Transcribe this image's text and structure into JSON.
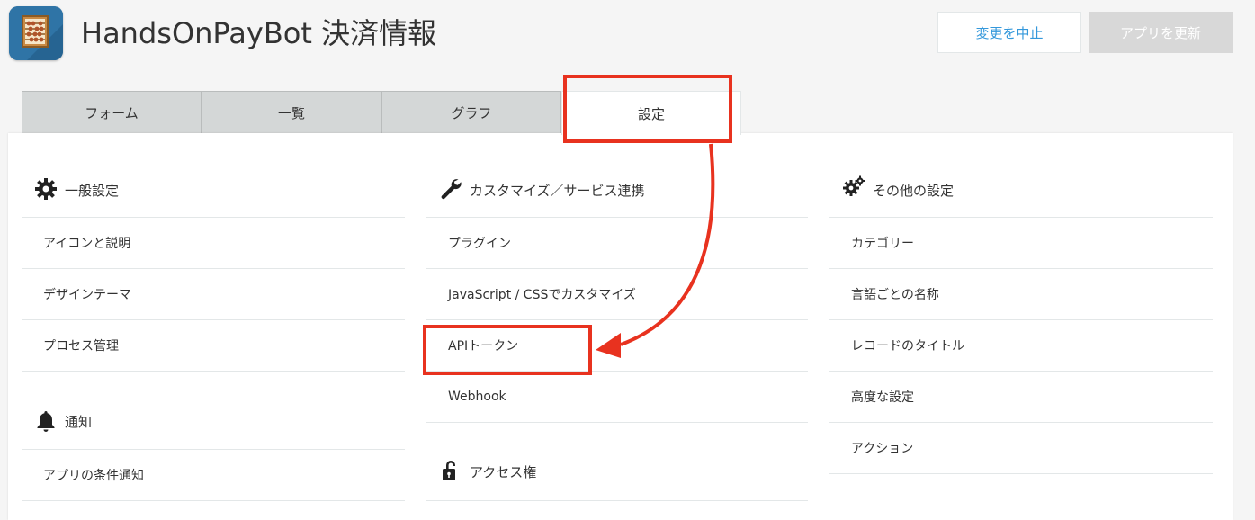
{
  "header": {
    "title": "HandsOnPayBot 決済情報",
    "cancel_label": "変更を中止",
    "update_label": "アプリを更新"
  },
  "tabs": [
    {
      "label": "フォーム",
      "active": false
    },
    {
      "label": "一覧",
      "active": false
    },
    {
      "label": "グラフ",
      "active": false
    },
    {
      "label": "設定",
      "active": true
    }
  ],
  "sections": {
    "general": {
      "title": "一般設定",
      "icon": "gear-icon",
      "items": [
        "アイコンと説明",
        "デザインテーマ",
        "プロセス管理"
      ]
    },
    "notifications": {
      "title": "通知",
      "icon": "bell-icon",
      "items": [
        "アプリの条件通知"
      ]
    },
    "customize": {
      "title": "カスタマイズ／サービス連携",
      "icon": "wrench-icon",
      "items": [
        "プラグイン",
        "JavaScript / CSSでカスタマイズ",
        "APIトークン",
        "Webhook"
      ]
    },
    "access": {
      "title": "アクセス権",
      "icon": "unlock-icon",
      "items": []
    },
    "other": {
      "title": "その他の設定",
      "icon": "gears-icon",
      "items": [
        "カテゴリー",
        "言語ごとの名称",
        "レコードのタイトル",
        "高度な設定",
        "アクション"
      ]
    }
  },
  "colors": {
    "accent": "#3498db",
    "annotation": "#e8321f",
    "tab_inactive": "#d4d7d7"
  }
}
